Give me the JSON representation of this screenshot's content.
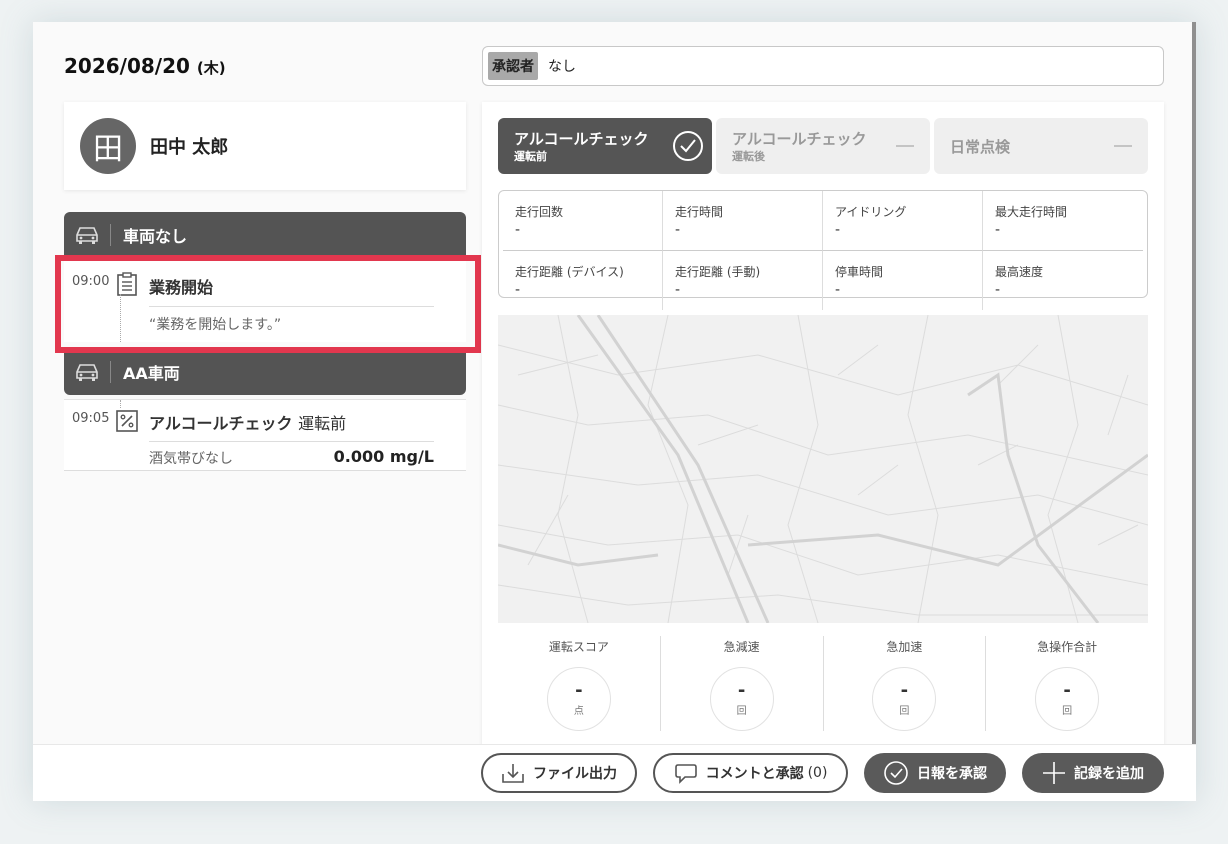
{
  "header": {
    "date": "2026/08/20",
    "weekday": "(木)"
  },
  "approver": {
    "tag": "承認者",
    "value": "なし"
  },
  "user": {
    "avatar_char": "田",
    "name": "田中 太郎"
  },
  "vehicles": [
    {
      "label": "車両なし"
    },
    {
      "label": "AA車両"
    }
  ],
  "entries": [
    {
      "time": "09:00",
      "title": "業務開始",
      "comment": "“業務を開始します。”"
    },
    {
      "time": "09:05",
      "title": "アルコールチェック",
      "title_suffix": "運転前",
      "result": "酒気帯びなし",
      "reading": "0.000 mg/L"
    }
  ],
  "tabs": [
    {
      "title": "アルコールチェック",
      "sub": "運転前",
      "status": "done"
    },
    {
      "title": "アルコールチェック",
      "sub": "運転後",
      "status": "none"
    },
    {
      "title": "日常点検",
      "sub": "",
      "status": "none"
    }
  ],
  "stats": [
    {
      "label": "走行回数",
      "value": "-"
    },
    {
      "label": "走行時間",
      "value": "-"
    },
    {
      "label": "アイドリング",
      "value": "-"
    },
    {
      "label": "最大走行時間",
      "value": "-"
    },
    {
      "label": "走行距離 (デバイス)",
      "value": "-"
    },
    {
      "label": "走行距離 (手動)",
      "value": "-"
    },
    {
      "label": "停車時間",
      "value": "-"
    },
    {
      "label": "最高速度",
      "value": "-"
    }
  ],
  "scores": [
    {
      "label": "運転スコア",
      "value": "-",
      "unit": "点"
    },
    {
      "label": "急減速",
      "value": "-",
      "unit": "回"
    },
    {
      "label": "急加速",
      "value": "-",
      "unit": "回"
    },
    {
      "label": "急操作合計",
      "value": "-",
      "unit": "回"
    }
  ],
  "footer": {
    "export_label": "ファイル出力",
    "comment_label": "コメントと承認",
    "comment_count": "(0)",
    "approve_label": "日報を承認",
    "add_label": "記録を追加"
  },
  "colors": {
    "highlight": "#e2374e",
    "dark": "#555555"
  }
}
